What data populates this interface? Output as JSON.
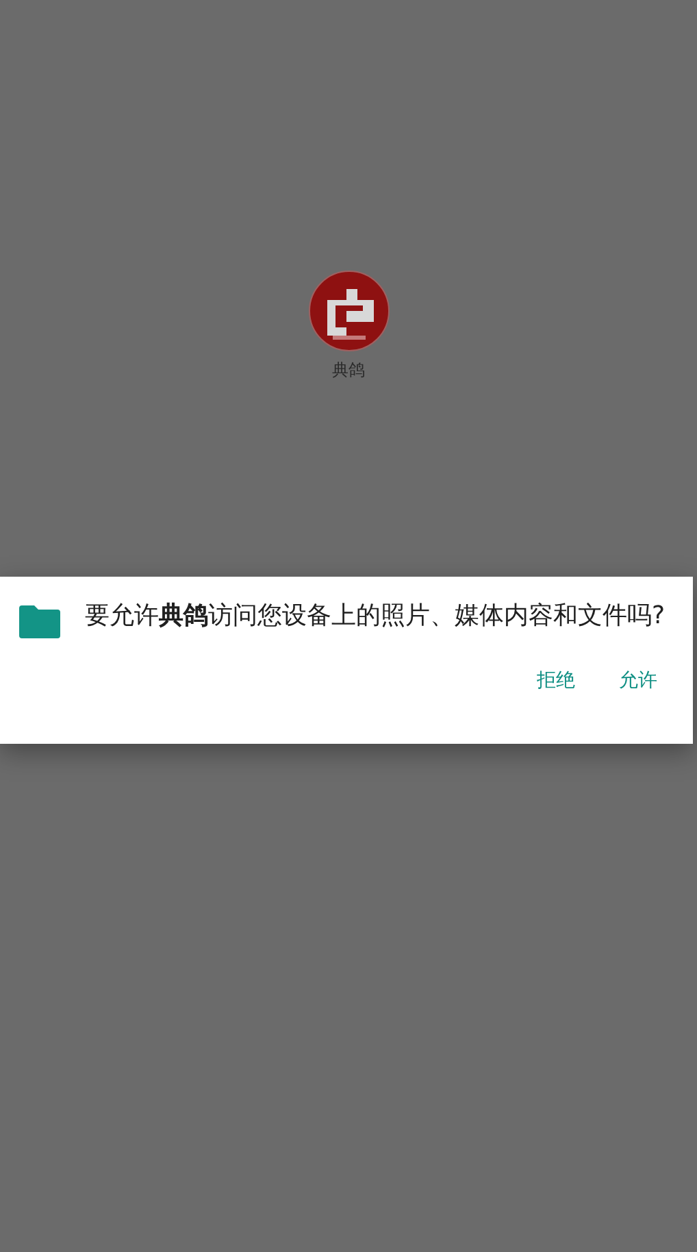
{
  "app": {
    "name": "典鸽"
  },
  "dialog": {
    "message": "要允许**典鸽**访问您设备上的照片、媒体内容和文件吗?",
    "buttons": [
      {
        "label": "拒绝"
      },
      {
        "label": "允许"
      }
    ]
  }
}
